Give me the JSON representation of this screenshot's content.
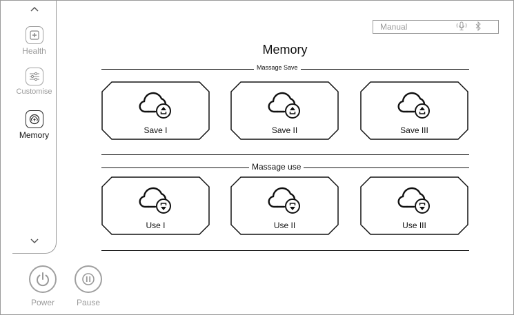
{
  "sidebar": {
    "items": [
      {
        "label": "Health",
        "icon": "health-plus-icon"
      },
      {
        "label": "Customise",
        "icon": "sliders-icon"
      },
      {
        "label": "Memory",
        "icon": "cloud-upload-icon",
        "active": true
      }
    ]
  },
  "status": {
    "mode": "Manual",
    "icons": [
      "voice-icon",
      "bluetooth-icon"
    ]
  },
  "page": {
    "title": "Memory"
  },
  "sections": {
    "save": {
      "label": "Massage Save",
      "cards": [
        {
          "label": "Save I"
        },
        {
          "label": "Save II"
        },
        {
          "label": "Save III"
        }
      ]
    },
    "use": {
      "label": "Massage use",
      "cards": [
        {
          "label": "Use I"
        },
        {
          "label": "Use II"
        },
        {
          "label": "Use III"
        }
      ]
    }
  },
  "controls": {
    "power": "Power",
    "pause": "Pause"
  },
  "colors": {
    "border": "#9a9a9a",
    "text": "#111111",
    "muted": "#9a9a9a"
  }
}
